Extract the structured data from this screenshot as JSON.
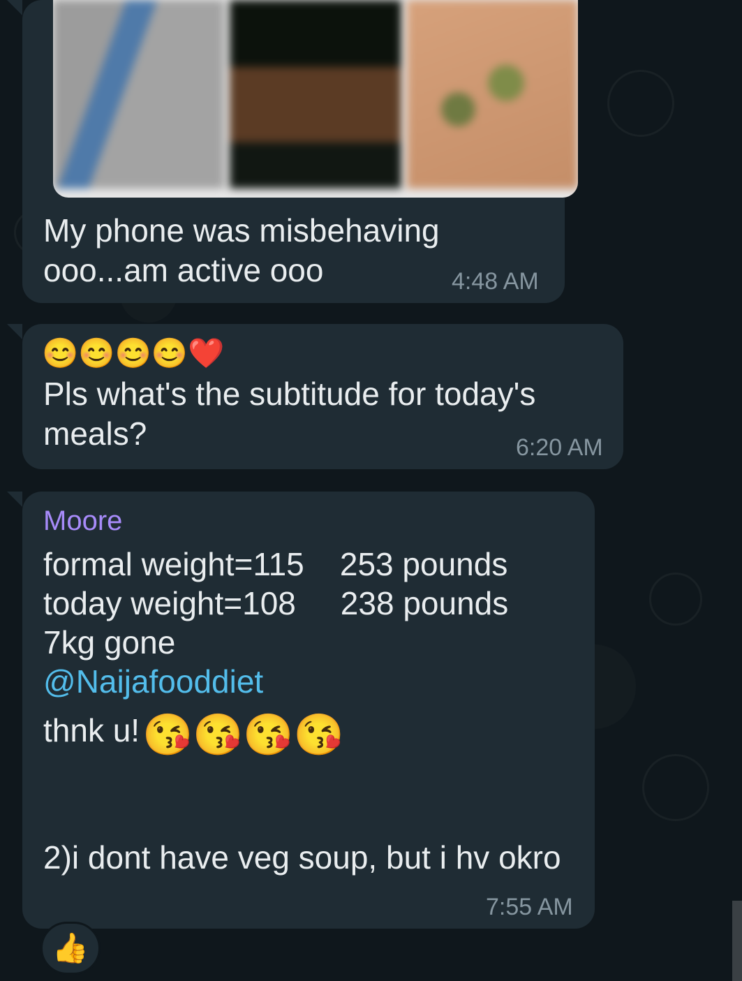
{
  "messages": [
    {
      "text": "My phone was misbehaving\nooo...am active ooo",
      "time": "4:48 AM"
    },
    {
      "emoji": "😊😊😊😊❤️",
      "text": "Pls what's the subtitude for today's\nmeals?",
      "time": "6:20 AM"
    },
    {
      "sender": "Moore",
      "line1": "formal weight=115    253 pounds",
      "line2": "today weight=108     238 pounds",
      "line3": "7kg gone",
      "mention": "@Naijafooddiet",
      "line5_prefix": "thnk u!",
      "line5_emoji": "😘😘😘😘",
      "line6": "2)i dont have veg soup, but i hv okro",
      "time": "7:55 AM"
    }
  ],
  "reaction": "👍",
  "colors": {
    "bubble": "#1f2c34",
    "text": "#e9edef",
    "time": "#8696a0",
    "sender": "#a78bfa",
    "mention": "#53bdeb"
  }
}
